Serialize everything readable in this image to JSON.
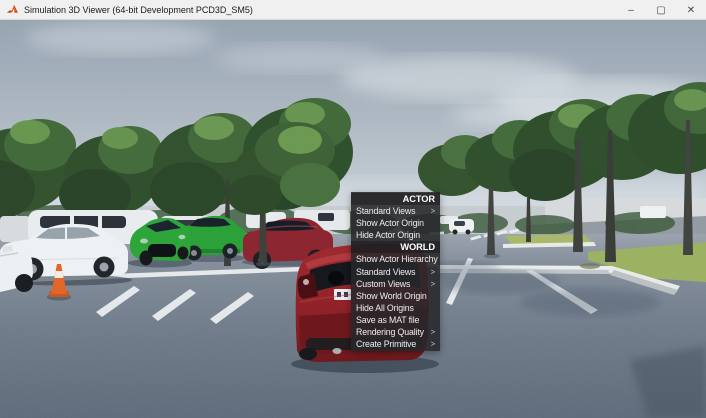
{
  "window": {
    "title": "Simulation 3D Viewer (64-bit Development PCD3D_SM5)",
    "controls": [
      {
        "name": "minimize",
        "glyph": "–"
      },
      {
        "name": "maximize",
        "glyph": "▢"
      },
      {
        "name": "close",
        "glyph": "✕"
      }
    ]
  },
  "colors": {
    "titlebar-bg": "#f0f0f0",
    "titlebar-text": "#1b1b1b",
    "matlab-orange": "#d9531e",
    "menu-bg": "#27272ae0",
    "menu-text": "#ededed",
    "sky-top": "#97a4b2",
    "sky-bottom": "#cfd7dd",
    "asphalt": "#6f7b8a",
    "marking-white": "#eef1f3",
    "grass-green": "#9db163",
    "tree-dark": "#33522f",
    "tree-light": "#6a9750",
    "car-white": "#eef1f3",
    "car-green": "#2ca039",
    "car-darkred": "#8c2630",
    "car-red": "#8f2228",
    "cone-orange": "#e2662a"
  },
  "context_menu": {
    "submenu_arrow": ">",
    "sections": [
      {
        "header": "ACTOR",
        "items": [
          {
            "label": "Standard Views",
            "submenu": true
          },
          {
            "label": "Show Actor Origin",
            "submenu": false
          },
          {
            "label": "Hide Actor Origin",
            "submenu": false
          }
        ]
      },
      {
        "header": "WORLD",
        "items": [
          {
            "label": "Show Actor Hierarchy",
            "submenu": false
          },
          {
            "label": "Standard Views",
            "submenu": true
          },
          {
            "label": "Custom Views",
            "submenu": true
          },
          {
            "label": "Show World Origin",
            "submenu": false
          },
          {
            "label": "Hide All Origins",
            "submenu": false
          },
          {
            "label": "Save as MAT file",
            "submenu": false
          },
          {
            "label": "Rendering Quality",
            "submenu": true
          },
          {
            "label": "Create Primitive",
            "submenu": true
          }
        ]
      }
    ]
  }
}
